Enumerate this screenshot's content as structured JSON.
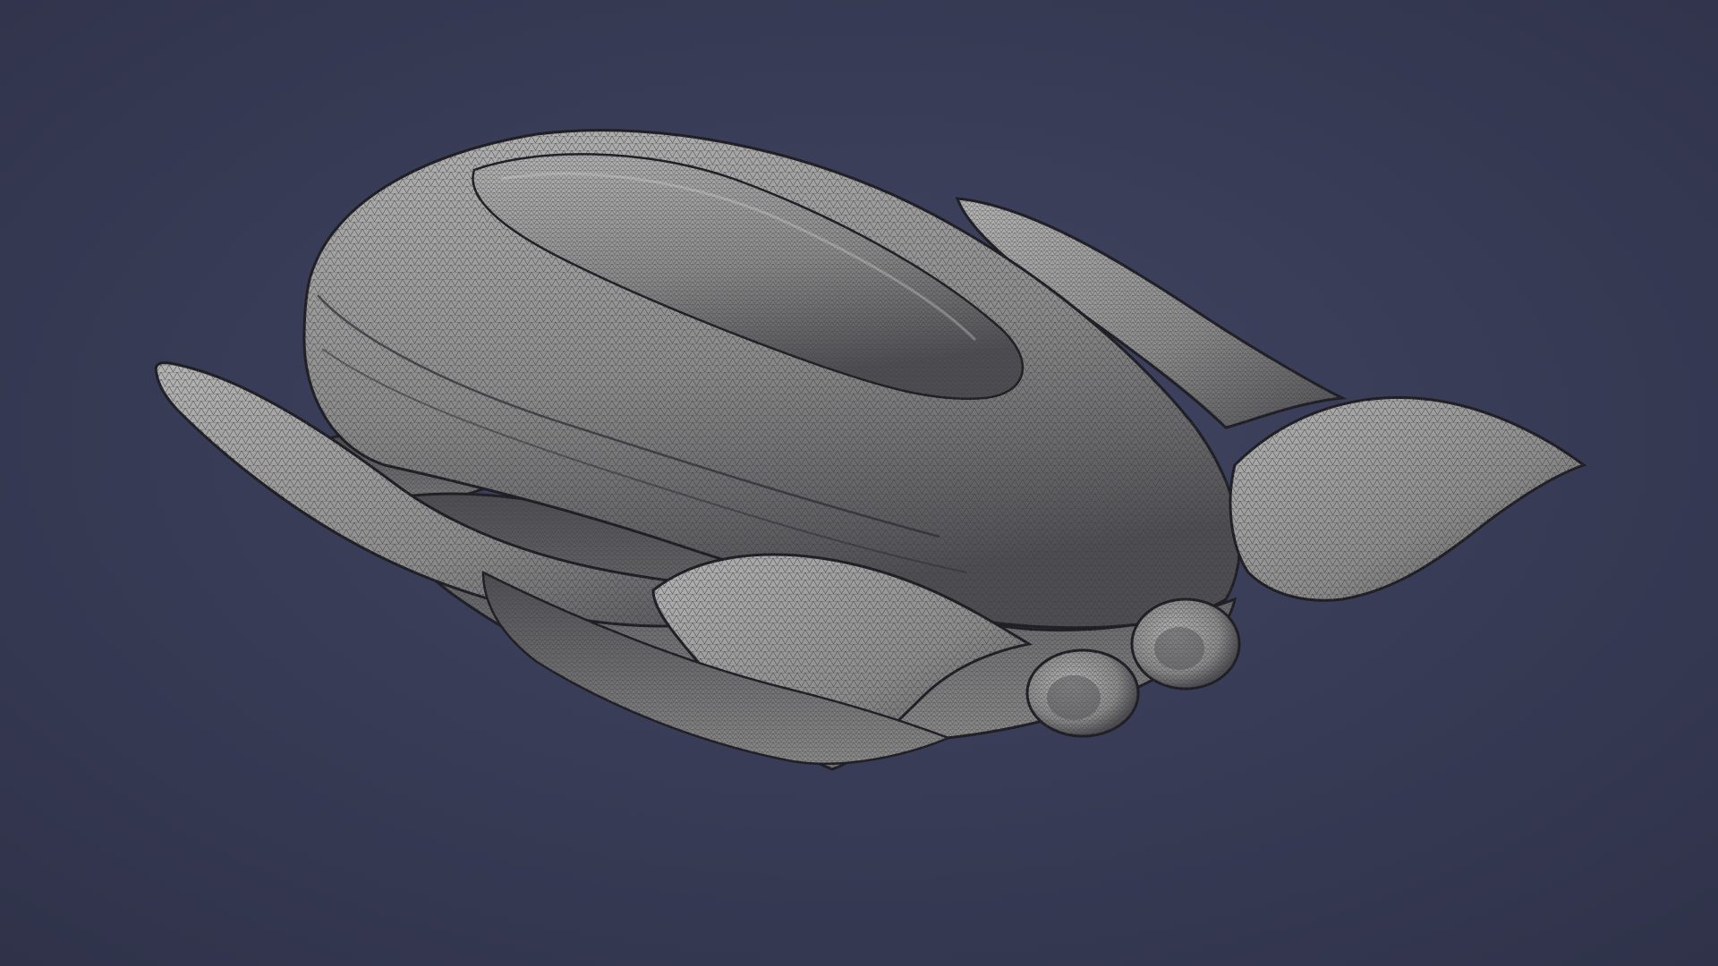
{
  "viewport": {
    "background_center": "#414562",
    "background_edge": "#2f3249",
    "mesh_fill": "#8a8a8a",
    "mesh_highlight": "#b4b4b4",
    "mesh_shadow": "#4e4e52",
    "wire_color": "#3c3c40",
    "outline_color": "#1e1e24",
    "shading_mode": "shaded-wireframe"
  },
  "model": {
    "parts": [
      "shell",
      "shell-top-panel",
      "left-rear-fin",
      "left-inner-fin",
      "right-rear-fin",
      "right-front-fin",
      "front-left-wing",
      "nose-pod-left",
      "nose-pod-right"
    ]
  }
}
